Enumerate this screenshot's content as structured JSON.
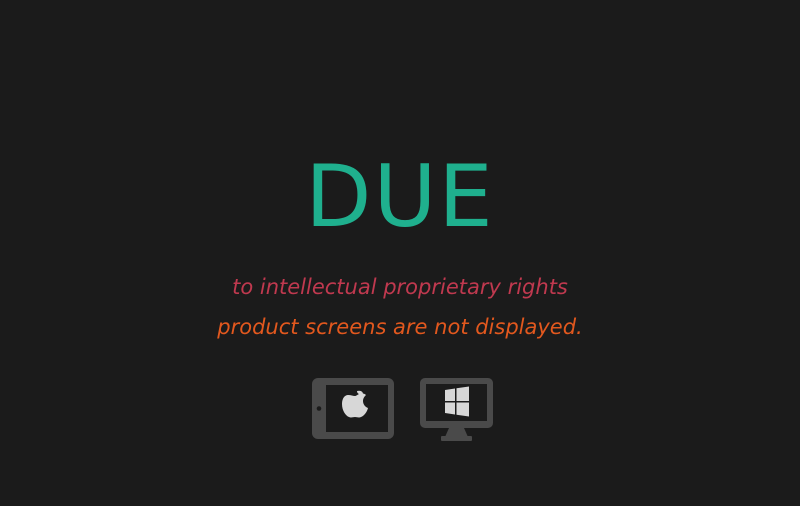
{
  "headline": "DUE",
  "message": {
    "line1": "to intellectual proprietary rights",
    "line2": "product screens are not displayed."
  },
  "icons": [
    {
      "name": "apple-tablet-icon"
    },
    {
      "name": "windows-monitor-icon"
    }
  ],
  "colors": {
    "background": "#1b1b1b",
    "headline": "#1fb08e",
    "line1": "#c0394f",
    "line2": "#e2581e",
    "icon_frame": "#4a4a4a",
    "icon_screen": "#1b1b1b",
    "icon_logo": "#d7d7d7"
  }
}
